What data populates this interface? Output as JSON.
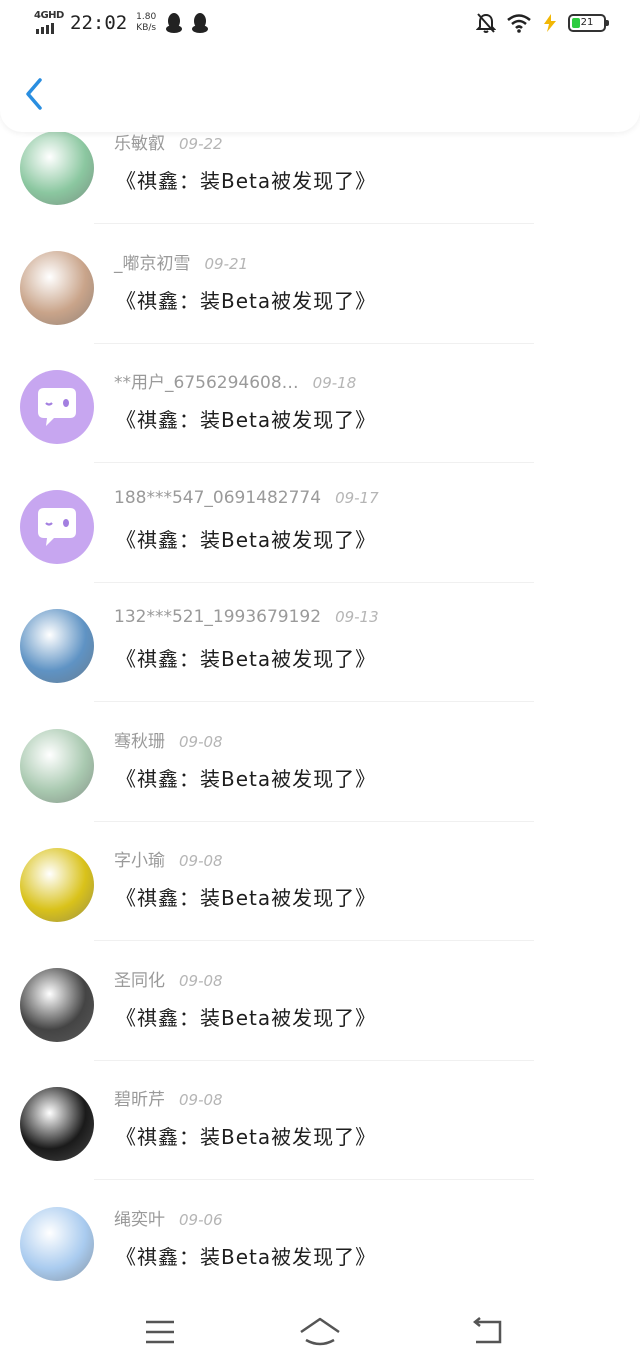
{
  "status_bar": {
    "network": "4GHD",
    "time": "22:02",
    "speed_value": "1.80",
    "speed_unit": "KB/s",
    "battery": "21",
    "icons": [
      "qq-icon",
      "qq-icon",
      "mute-bell-icon",
      "wifi-icon",
      "charging-icon",
      "battery-icon"
    ]
  },
  "header": {
    "back_icon": "chevron-left-icon",
    "accent": "#2a8ee0"
  },
  "comments": [
    {
      "user": "乐敏叡",
      "date": "09-22",
      "text": "《祺鑫：装Beta被发现了》",
      "avatar": "lily-flower",
      "color": "#8bc7a0"
    },
    {
      "user": "_嘟京初雪",
      "date": "09-21",
      "text": "《祺鑫：装Beta被发现了》",
      "avatar": "girl-photo",
      "color": "#c9a48a"
    },
    {
      "user": "**用户_6756294608…",
      "date": "09-18",
      "text": "《祺鑫：装Beta被发现了》",
      "avatar": "default-purple",
      "color": "#c7a6f0"
    },
    {
      "user": "188***547_0691482774",
      "date": "09-17",
      "text": "《祺鑫：装Beta被发现了》",
      "avatar": "default-purple",
      "color": "#c7a6f0"
    },
    {
      "user": "132***521_1993679192",
      "date": "09-13",
      "text": "《祺鑫：装Beta被发现了》",
      "avatar": "beach-girl",
      "color": "#5f93c4"
    },
    {
      "user": "骞秋珊",
      "date": "09-08",
      "text": "《祺鑫：装Beta被发现了》",
      "avatar": "window-plant",
      "color": "#a9c9b0"
    },
    {
      "user": "字小瑜",
      "date": "09-08",
      "text": "《祺鑫：装Beta被发现了》",
      "avatar": "yellow-flower",
      "color": "#d9c21a"
    },
    {
      "user": "圣同化",
      "date": "09-08",
      "text": "《祺鑫：装Beta被发现了》",
      "avatar": "anime-sketch",
      "color": "#444444"
    },
    {
      "user": "碧昕芹",
      "date": "09-08",
      "text": "《祺鑫：装Beta被发现了》",
      "avatar": "dark-anime",
      "color": "#1a1a1a"
    },
    {
      "user": "绳奕叶",
      "date": "09-06",
      "text": "《祺鑫：装Beta被发现了》",
      "avatar": "blue-cartoon",
      "color": "#a9cbef"
    }
  ],
  "nav": {
    "icons": [
      "menu-icon",
      "home-icon",
      "back-icon"
    ]
  }
}
